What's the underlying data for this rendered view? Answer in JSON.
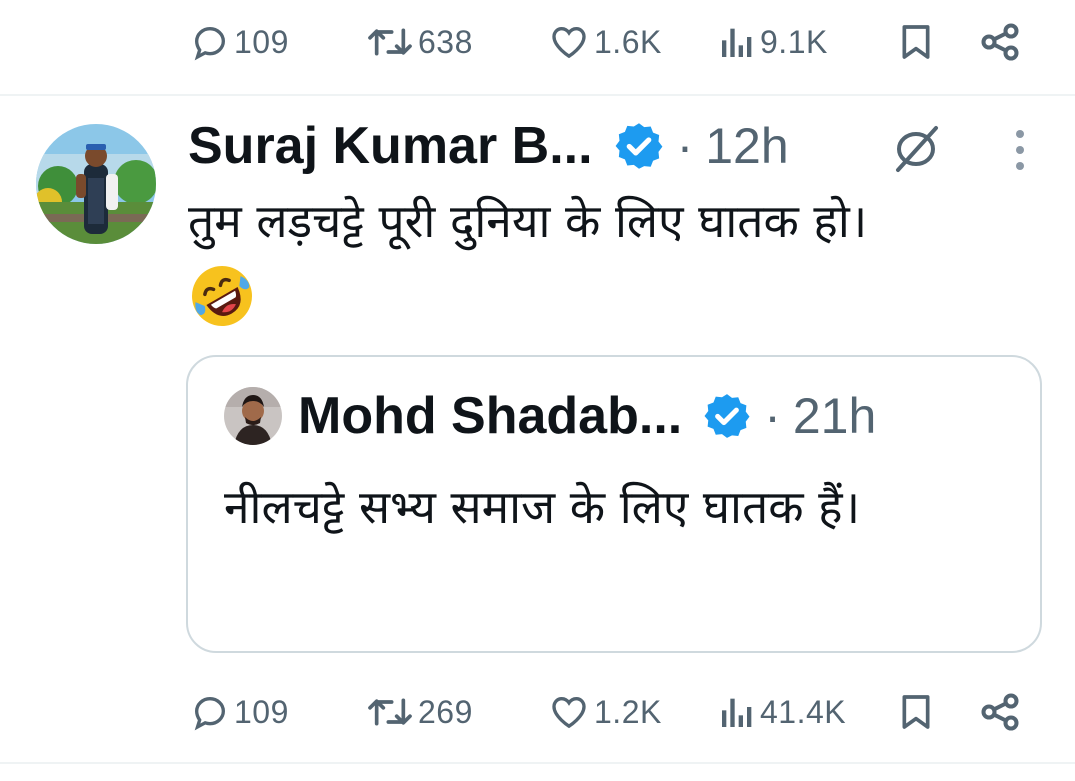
{
  "top_actions": {
    "replies": "109",
    "reposts": "638",
    "likes": "1.6K",
    "views": "9.1K"
  },
  "tweet": {
    "author_name": "Suraj Kumar B...",
    "separator": "·",
    "time": "12h",
    "text": "तुम लड़चट्टे पूरी दुनिया के लिए घातक हो।",
    "emoji": "rolling-on-floor-laughing-emoji"
  },
  "quoted_tweet": {
    "author_name": "Mohd Shadab...",
    "separator": "·",
    "time": "21h",
    "text": "नीलचट्टे सभ्य समाज के लिए घातक हैं।"
  },
  "bottom_actions": {
    "replies": "109",
    "reposts": "269",
    "likes": "1.2K",
    "views": "41.4K"
  },
  "colors": {
    "verified": "#1d9bf0",
    "muted_text": "#536471",
    "border": "#cfd9de",
    "emoji_face": "#f7c21e"
  }
}
